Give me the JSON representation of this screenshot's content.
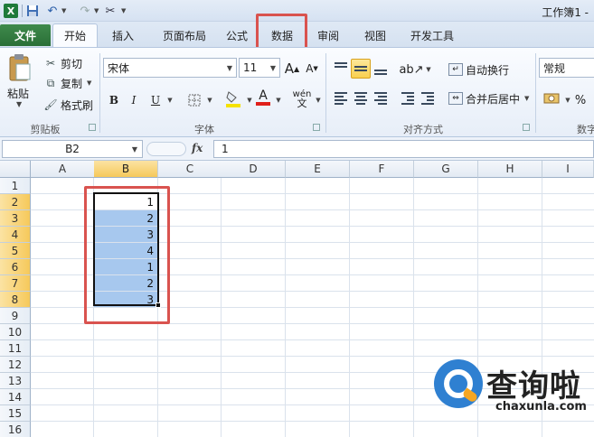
{
  "window": {
    "title": "工作簿1 -"
  },
  "tabs": [
    {
      "label": "文件"
    },
    {
      "label": "开始"
    },
    {
      "label": "插入"
    },
    {
      "label": "页面布局"
    },
    {
      "label": "公式"
    },
    {
      "label": "数据"
    },
    {
      "label": "审阅"
    },
    {
      "label": "视图"
    },
    {
      "label": "开发工具"
    }
  ],
  "clipboard": {
    "paste": "粘贴",
    "cut": "剪切",
    "copy": "复制",
    "format_painter": "格式刷",
    "group": "剪贴板"
  },
  "font": {
    "name": "宋体",
    "size": "11",
    "bold": "B",
    "italic": "I",
    "underline": "U",
    "grow": "A",
    "shrink": "A",
    "group": "字体",
    "font_color_glyph": "A",
    "phonetic_glyph": "wén"
  },
  "alignment": {
    "wrap_text": "自动换行",
    "merge_center": "合并后居中",
    "group": "对齐方式"
  },
  "number": {
    "format": "常规",
    "percent": "%",
    "group": "数字"
  },
  "formula_bar": {
    "name_box": "B2",
    "fx": "fx",
    "value": "1"
  },
  "grid": {
    "columns": [
      "A",
      "B",
      "C",
      "D",
      "E",
      "F",
      "G",
      "H",
      "I"
    ],
    "rows": [
      "1",
      "2",
      "3",
      "4",
      "5",
      "6",
      "7",
      "8",
      "9",
      "10",
      "11",
      "12",
      "13",
      "14",
      "15",
      "16"
    ],
    "column_b_values": [
      "1",
      "2",
      "3",
      "4",
      "1",
      "2",
      "3"
    ]
  },
  "watermark": {
    "brand": "查询啦",
    "url": "chaxunla.com"
  },
  "colors": {
    "selection": "#a7c8ee",
    "highlight_frame": "#d9534f",
    "file_tab": "#2a6f37",
    "header_selected": "#f6c95b"
  }
}
